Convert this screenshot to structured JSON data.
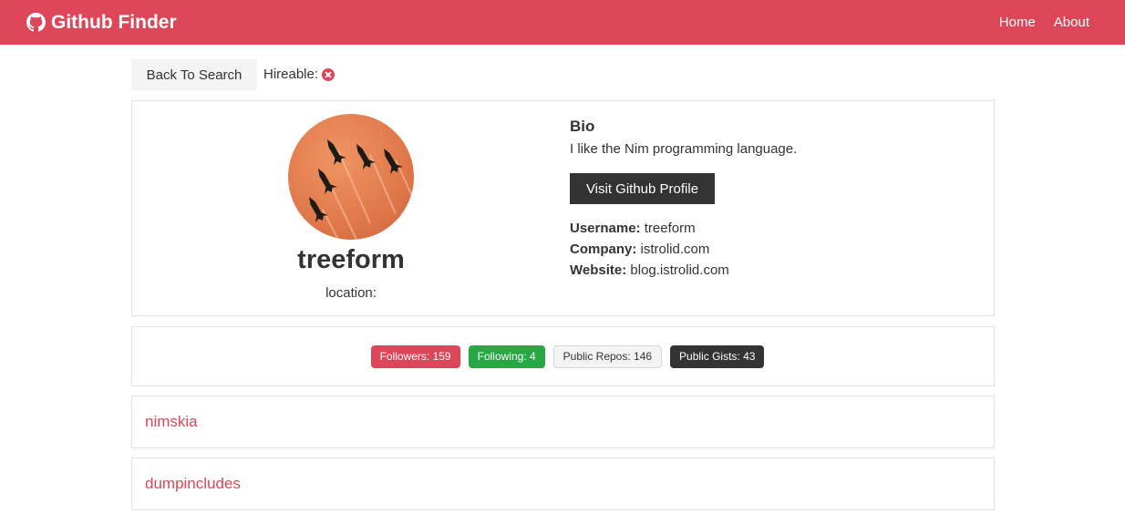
{
  "navbar": {
    "brand": "Github Finder",
    "brand_icon": "github-icon",
    "links": [
      "Home",
      "About"
    ],
    "color": "#dc4658"
  },
  "toolbar": {
    "back_label": "Back To Search",
    "hireable_label": "Hireable:",
    "hireable_icon": "x-circle-icon"
  },
  "profile": {
    "login": "treeform",
    "location_label": "location:",
    "bio_title": "Bio",
    "bio": "I like the Nim programming language.",
    "visit_label": "Visit Github Profile",
    "username_label": "Username:",
    "username": "treeform",
    "company_label": "Company:",
    "company": "istrolid.com",
    "website_label": "Website:",
    "website": "blog.istrolid.com"
  },
  "stats": {
    "followers": "Followers: 159",
    "following": "Following: 4",
    "public_repos": "Public Repos: 146",
    "public_gists": "Public Gists: 43"
  },
  "repos": [
    {
      "name": "nimskia"
    },
    {
      "name": "dumpincludes"
    }
  ]
}
